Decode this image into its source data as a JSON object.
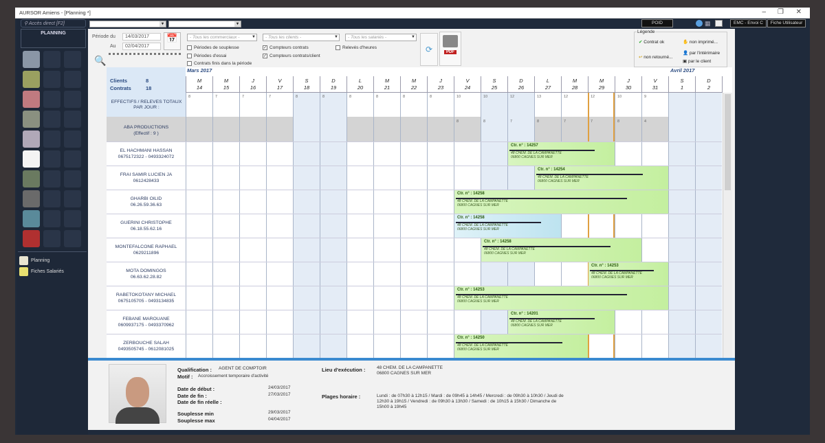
{
  "window": {
    "title": "AURSOR Amiens - [Planning *]"
  },
  "sidebar": {
    "search_placeholder": "Accès direct [F2]",
    "section": "PLANNING",
    "items": [
      {
        "label": "Planning"
      },
      {
        "label": "Fiches Salariés"
      }
    ]
  },
  "topbar": {
    "poid": "POID",
    "emc": "EMC - Envoi C",
    "fiche": "Fiche Utilisateur"
  },
  "toolbar": {
    "periode_du_label": "Période du",
    "periode_du": "14/03/2017",
    "au_label": "Au",
    "au": "02/04/2017",
    "commerciaux": "- Tous les commerciaux -",
    "clients": "- Tous les clients -",
    "salaries": "- Tous les salariés -",
    "checks": [
      {
        "label": "Périodes de souplesse",
        "checked": false
      },
      {
        "label": "Périodes d'essai",
        "checked": false
      },
      {
        "label": "Contrats finis dans la période",
        "checked": false
      },
      {
        "label": "Compteurs contrats",
        "checked": true
      },
      {
        "label": "Compteurs contrats/client",
        "checked": true
      },
      {
        "label": "Relevés d'heures",
        "checked": false
      }
    ],
    "pdf": "PDF"
  },
  "legend": {
    "title": "Légende",
    "items": [
      "Contrat ok",
      "non imprimé...",
      "non retourné...",
      "par l'intérimaire",
      "par le client"
    ]
  },
  "summary": {
    "clients_label": "Clients",
    "clients": "8",
    "contrats_label": "Contrats",
    "contrats": "18",
    "totals_label": "EFFECTIFS / RELEVES TOTAUX PAR JOUR :"
  },
  "months": [
    {
      "label": "Mars 2017"
    },
    {
      "label": "Avril 2017"
    }
  ],
  "days": [
    {
      "l": "M",
      "d": "14",
      "t": "8"
    },
    {
      "l": "M",
      "d": "15",
      "t": "7"
    },
    {
      "l": "J",
      "d": "16",
      "t": "7"
    },
    {
      "l": "V",
      "d": "17",
      "t": "7"
    },
    {
      "l": "S",
      "d": "18",
      "t": "8",
      "w": 1
    },
    {
      "l": "D",
      "d": "19",
      "t": "8",
      "w": 1
    },
    {
      "l": "L",
      "d": "20",
      "t": "8"
    },
    {
      "l": "M",
      "d": "21",
      "t": "8"
    },
    {
      "l": "M",
      "d": "22",
      "t": "8"
    },
    {
      "l": "J",
      "d": "23",
      "t": "8"
    },
    {
      "l": "V",
      "d": "24",
      "t": "10",
      "c": "8"
    },
    {
      "l": "S",
      "d": "25",
      "t": "10",
      "c": "8",
      "w": 1
    },
    {
      "l": "D",
      "d": "26",
      "t": "12",
      "c": "7",
      "w": 1
    },
    {
      "l": "L",
      "d": "27",
      "t": "13",
      "c": "8"
    },
    {
      "l": "M",
      "d": "28",
      "t": "12",
      "c": "7"
    },
    {
      "l": "M",
      "d": "29",
      "t": "12",
      "c": "7",
      "today": 1
    },
    {
      "l": "J",
      "d": "30",
      "t": "10",
      "c": "8"
    },
    {
      "l": "V",
      "d": "31",
      "t": "9",
      "c": "4"
    },
    {
      "l": "S",
      "d": "1",
      "w": 1
    },
    {
      "l": "D",
      "d": "2",
      "w": 1
    }
  ],
  "company": {
    "name": "ABA PRODUCTIONS",
    "effectif": "(Effectif : 9 )"
  },
  "employees": [
    {
      "name": "EL HACHMANI HASSAN",
      "phone": "0675172322 - 0493324072",
      "ctr": "Ctr. n° : 14257",
      "start": 12,
      "len": 4
    },
    {
      "name": "FRAI SAMIR LUCIEN JA",
      "phone": "0612428433",
      "ctr": "Ctr. n° : 14254",
      "start": 13,
      "len": 5
    },
    {
      "name": "GHARBI OILID",
      "phone": "06.26.59.36.63",
      "ctr": "Ctr. n° : 14258",
      "start": 10,
      "len": 8
    },
    {
      "name": "GUERINI CHRISTOPHE",
      "phone": "06.18.55.62.16",
      "ctr": "Ctr. n° : 14258",
      "start": 10,
      "len": 4,
      "blue": 1
    },
    {
      "name": "MONTEFALCONE RAPHAEL",
      "phone": "0629211896",
      "ctr": "Ctr. n° : 14258",
      "start": 11,
      "len": 6
    },
    {
      "name": "MOTA DOMINGOS",
      "phone": "06.63.62.28.82",
      "ctr": "Ctr. n° : 14253",
      "start": 15,
      "len": 3
    },
    {
      "name": "RABETOKOTANY MICHAEL",
      "phone": "0675105705 - 0493134835",
      "ctr": "Ctr. n° : 14253",
      "start": 10,
      "len": 8
    },
    {
      "name": "FEBANE MAROUANE",
      "phone": "0609937175 - 0493370962",
      "ctr": "Ctr. n° : 14201",
      "start": 12,
      "len": 4
    },
    {
      "name": "ZERBOUCHE SALAH",
      "phone": "0493505745 - 0612081025",
      "ctr": "Ctr. n° : 14250",
      "start": 10,
      "len": 5
    }
  ],
  "bar_address": [
    "48 CHEM. DE LA CAMPANETTE",
    "06800 CAGNES SUR MER"
  ],
  "detail": {
    "qualification_label": "Qualification :",
    "qualification": "AGENT DE COMPTOIR",
    "motif_label": "Motif :",
    "motif": "Accroissement temporaire d'activité",
    "debut_label": "Date de début :",
    "debut": "24/03/2017",
    "fin_label": "Date de fin :",
    "fin": "27/03/2017",
    "fin_reelle_label": "Date de fin réelle :",
    "smin_label": "Souplesse min",
    "smin": "29/03/2017",
    "smax_label": "Souplesse max",
    "smax": "04/04/2017",
    "lieu_label": "Lieu d'exécution :",
    "lieu1": "48 CHEM. DE LA CAMPANETTE",
    "lieu2": "06800 CAGNES SUR MER",
    "plages_label": "Plages horaire :",
    "plages": "Lundi : de 07h30 à 12h15 / Mardi : de 09h45 à 14h45 / Mercredi : de 09h30 à 10h30 / Jeudi de 12h30 à 19h15 / Vendredi : de 09h30 à 13h30 / Samedi : de 10h15 à 15h30 / Dimanche de 15h00 à 19h45"
  }
}
